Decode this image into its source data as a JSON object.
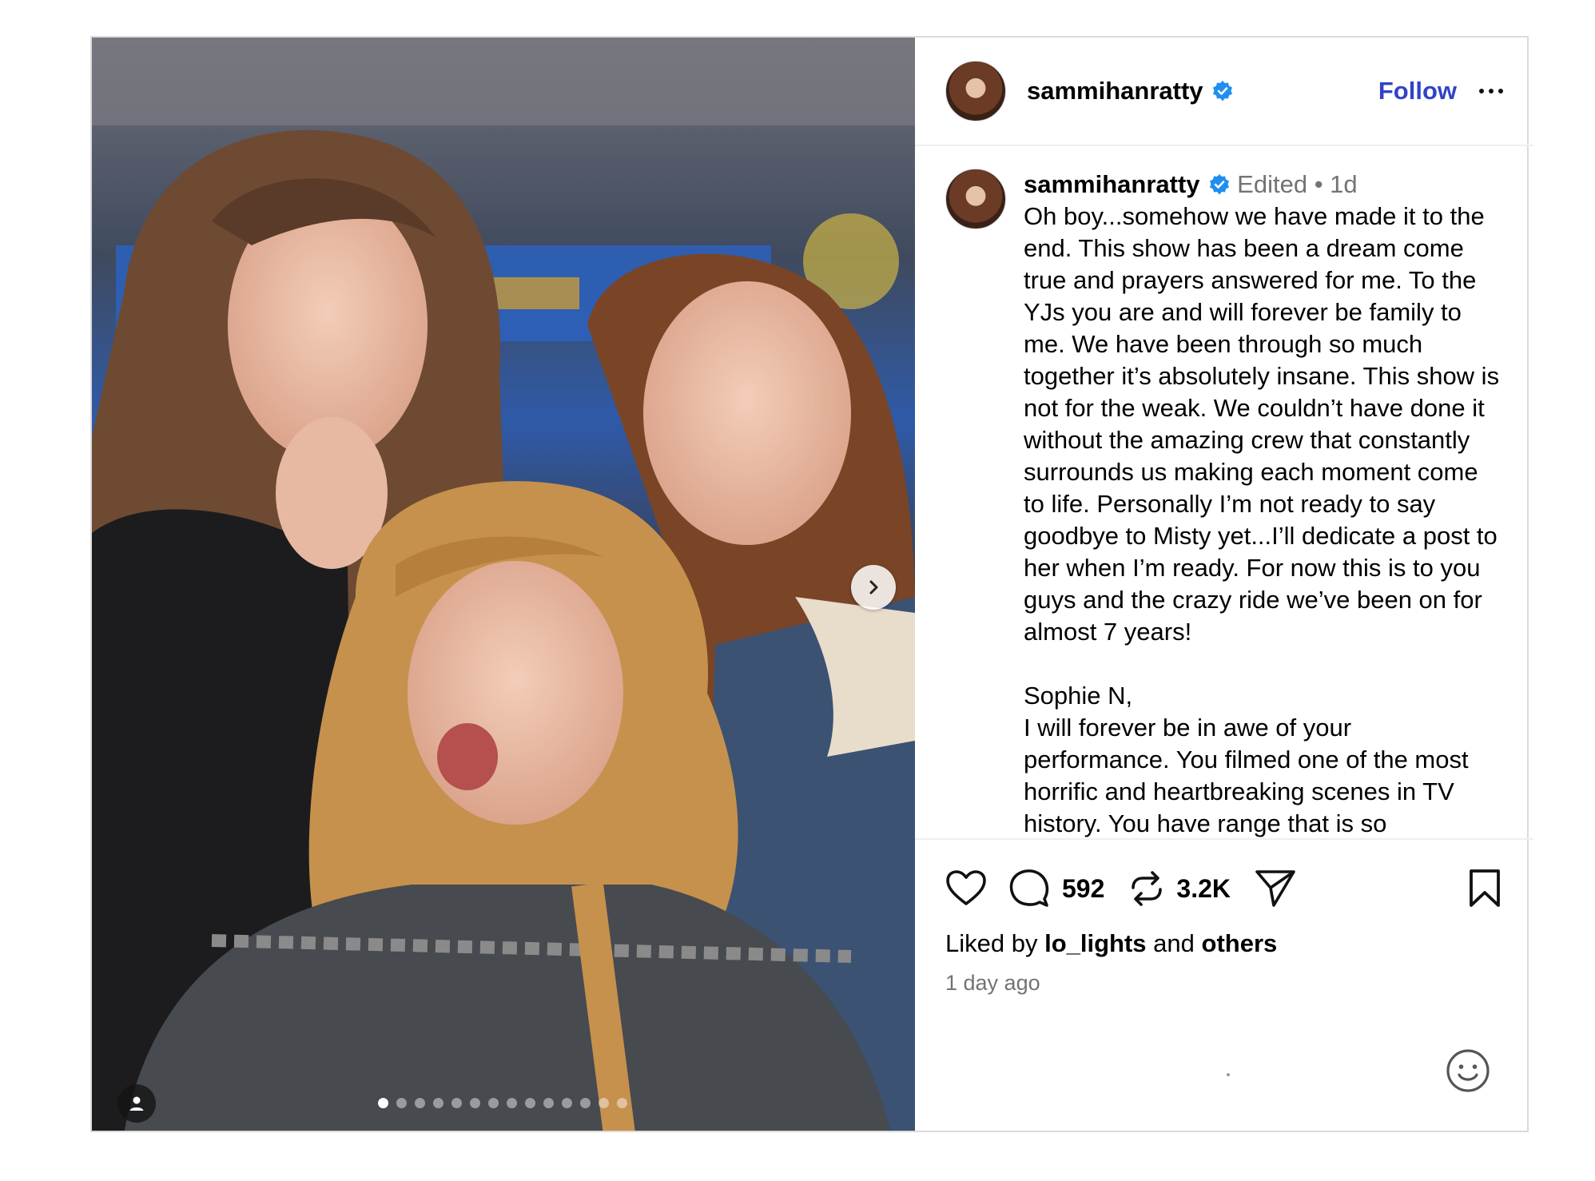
{
  "header": {
    "username": "sammihanratty",
    "follow_label": "Follow"
  },
  "caption": {
    "username": "sammihanratty",
    "edited": "Edited",
    "age": "1d",
    "text": "Oh boy...somehow we have made it to the end. This show has been a dream come true and prayers answered for me. To the YJs you are and will forever be family to me. We have been through so much together it’s absolutely insane. This show is not for the weak. We couldn’t have done it without the amazing crew that constantly surrounds us making each moment come to life. Personally I’m not ready to say goodbye to Misty yet...I’ll dedicate a post to her when I’m ready. For now this is to you guys and the crazy ride we’ve been on for almost 7 years!\n\nSophie N,\nI will forever be in awe of your performance. You filmed one of the most horrific and heartbreaking scenes in TV history. You have range that is so"
  },
  "actions": {
    "comment_count": "592",
    "repost_count": "3.2K"
  },
  "likes": {
    "prefix": "Liked by",
    "user": "lo_lights",
    "connector": "and",
    "others": "others"
  },
  "posted": "1 day ago",
  "carousel": {
    "total_slides": 14,
    "current_slide": 1
  },
  "colors": {
    "follow": "#3143c8",
    "verified": "#1f8ef1",
    "muted": "#737373"
  },
  "icons": [
    "verified-badge-icon",
    "more-options-icon",
    "chevron-right-icon",
    "user-tag-icon",
    "heart-icon",
    "comment-icon",
    "repost-icon",
    "share-icon",
    "bookmark-icon",
    "emoji-icon"
  ]
}
